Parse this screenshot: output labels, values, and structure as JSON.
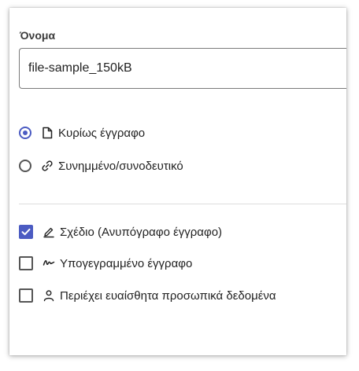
{
  "form": {
    "name_label": "Όνομα",
    "name_value": "file-sample_150kB",
    "doc_type": {
      "selected": "main",
      "options": [
        {
          "id": "main",
          "label": "Κυρίως έγγραφο",
          "icon": "file-icon",
          "checked": true
        },
        {
          "id": "attachment",
          "label": "Συνημμένο/συνοδευτικό",
          "icon": "link-icon",
          "checked": false
        }
      ]
    },
    "flags": [
      {
        "id": "draft",
        "label": "Σχέδιο (Ανυπόγραφο έγγραφο)",
        "icon": "pen-icon",
        "checked": true
      },
      {
        "id": "signed",
        "label": "Υπογεγραμμένο έγγραφο",
        "icon": "signature-icon",
        "checked": false
      },
      {
        "id": "sensitive",
        "label": "Περιέχει ευαίσθητα προσωπικά δεδομένα",
        "icon": "person-icon",
        "checked": false
      }
    ]
  },
  "colors": {
    "accent": "#4b5bc2",
    "text": "#222222",
    "control_border": "#555555",
    "divider": "#dddddd"
  }
}
